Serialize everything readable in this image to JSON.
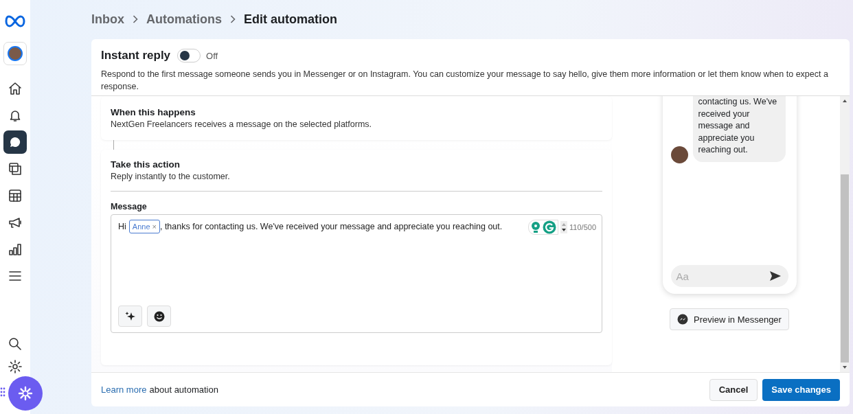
{
  "sidebar": {
    "items": [
      {
        "selected": false
      },
      {
        "selected": false
      },
      {
        "selected": true
      },
      {
        "selected": false
      },
      {
        "selected": false
      },
      {
        "selected": false
      },
      {
        "selected": false
      },
      {
        "selected": false
      }
    ]
  },
  "breadcrumb": [
    {
      "label": "Inbox",
      "current": false
    },
    {
      "label": "Automations",
      "current": false
    },
    {
      "label": "Edit automation",
      "current": true
    }
  ],
  "header": {
    "title": "Instant reply",
    "toggle_on": false,
    "toggle_label": "Off",
    "description": "Respond to the first message someone sends you in Messenger or on Instagram. You can customize your message to say hello, give them more information or let them know when to expect a response."
  },
  "trigger": {
    "title": "When this happens",
    "subtitle": "NextGen Freelancers receives a message on the selected platforms."
  },
  "action": {
    "title": "Take this action",
    "subtitle": "Reply instantly to the customer.",
    "message_label": "Message",
    "message_before": "Hi",
    "tag": "Anne",
    "tag_remove": "×",
    "message_after": ", thanks for contacting us. We've received your message and appreciate you reaching out.",
    "counter": "110/500"
  },
  "preview": {
    "bubble": "contacting us. We've received your message and appreciate you reaching out.",
    "composer_placeholder": "Aa",
    "button": "Preview in Messenger"
  },
  "footer": {
    "link": "Learn more",
    "text": "about automation",
    "cancel": "Cancel",
    "save": "Save changes"
  }
}
